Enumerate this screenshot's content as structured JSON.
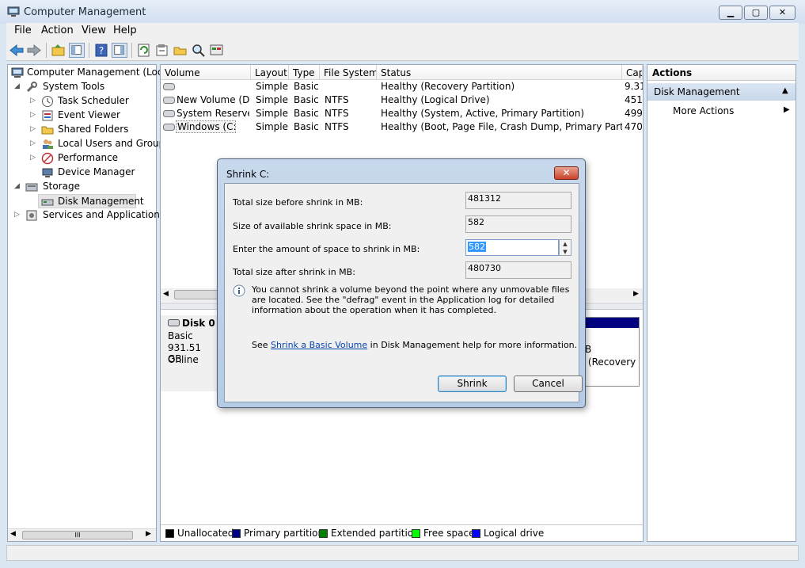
{
  "window": {
    "title": "Computer Management",
    "min": "▁",
    "max": "▢",
    "close": "✕"
  },
  "menu": [
    "File",
    "Action",
    "View",
    "Help"
  ],
  "tree": {
    "items": [
      {
        "label": "Computer Management (Local"
      },
      {
        "label": "System Tools"
      },
      {
        "label": "Task Scheduler"
      },
      {
        "label": "Event Viewer"
      },
      {
        "label": "Shared Folders"
      },
      {
        "label": "Local Users and Groups"
      },
      {
        "label": "Performance"
      },
      {
        "label": "Device Manager"
      },
      {
        "label": "Storage"
      },
      {
        "label": "Disk Management"
      },
      {
        "label": "Services and Applications"
      }
    ],
    "scroll_thumb": "III"
  },
  "volumes": {
    "columns": [
      "Volume",
      "Layout",
      "Type",
      "File System",
      "Status",
      "Cap"
    ],
    "rows": [
      [
        "",
        "Simple",
        "Basic",
        "",
        "Healthy (Recovery Partition)",
        "9.31"
      ],
      [
        "New Volume (D:)",
        "Simple",
        "Basic",
        "NTFS",
        "Healthy (Logical Drive)",
        "451.("
      ],
      [
        "System Reserved",
        "Simple",
        "Basic",
        "NTFS",
        "Healthy (System, Active, Primary Partition)",
        "499"
      ],
      [
        "Windows (C:)",
        "Simple",
        "Basic",
        "NTFS",
        "Healthy (Boot, Page File, Crash Dump, Primary Partition)",
        "470.("
      ]
    ]
  },
  "disk": {
    "name": "Disk 0",
    "type": "Basic",
    "size": "931.51 GB",
    "state": "Online",
    "partial_b": "B",
    "partial_recovery": "y (Recovery"
  },
  "legend": [
    {
      "label": "Unallocated",
      "color": "#000000"
    },
    {
      "label": "Primary partition",
      "color": "#000080"
    },
    {
      "label": "Extended partition",
      "color": "#008000"
    },
    {
      "label": "Free space",
      "color": "#00ff00"
    },
    {
      "label": "Logical drive",
      "color": "#0000ff"
    }
  ],
  "actions": {
    "header": "Actions",
    "section": "Disk Management",
    "more": "More Actions"
  },
  "dialog": {
    "title": "Shrink C:",
    "close": "✕",
    "total_before_label": "Total size before shrink in MB:",
    "total_before_value": "481312",
    "available_label": "Size of available shrink space in MB:",
    "available_value": "582",
    "amount_label": "Enter the amount of space to shrink in MB:",
    "amount_value": "582",
    "total_after_label": "Total size after shrink in MB:",
    "total_after_value": "480730",
    "info": "You cannot shrink a volume beyond the point where any unmovable files are located. See the \"defrag\" event in the Application log for detailed information about the operation when it has completed.",
    "help_prefix": "See",
    "help_link": "Shrink a Basic Volume",
    "help_suffix": "in Disk Management help for more information.",
    "shrink_button": "Shrink",
    "cancel_button": "Cancel"
  }
}
